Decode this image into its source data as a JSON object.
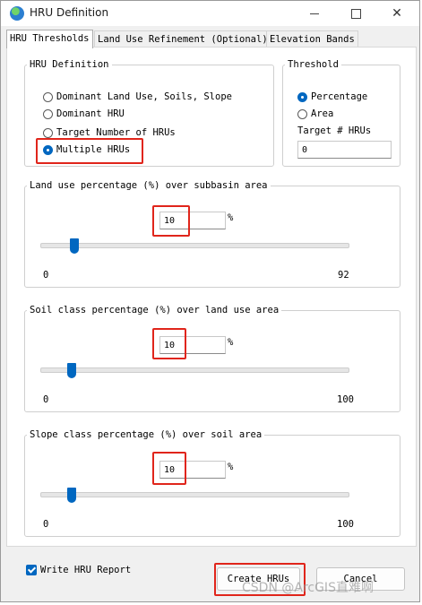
{
  "window": {
    "title": "HRU Definition",
    "minimize_icon": "minimize-icon",
    "maximize_icon": "maximize-icon",
    "close_icon": "close-icon",
    "close_glyph": "✕"
  },
  "tabs": [
    {
      "label": "HRU Thresholds",
      "active": true
    },
    {
      "label": "Land Use Refinement (Optional)",
      "active": false
    },
    {
      "label": "Elevation Bands",
      "active": false
    }
  ],
  "hru_definition": {
    "legend": "HRU Definition",
    "options": [
      {
        "label": "Dominant Land Use, Soils, Slope",
        "checked": false
      },
      {
        "label": "Dominant HRU",
        "checked": false
      },
      {
        "label": "Target Number of HRUs",
        "checked": false
      },
      {
        "label": "Multiple HRUs",
        "checked": true
      }
    ]
  },
  "threshold": {
    "legend": "Threshold",
    "options": [
      {
        "label": "Percentage",
        "checked": true
      },
      {
        "label": "Area",
        "checked": false
      }
    ],
    "target_label": "Target # HRUs",
    "target_value": "0"
  },
  "land_use": {
    "legend": "Land use percentage (%) over subbasin area",
    "value": "10",
    "unit": "%",
    "min_label": "0",
    "max_label": "92",
    "slider_fraction": 0.109
  },
  "soil": {
    "legend": "Soil class percentage (%) over land use area",
    "value": "10",
    "unit": "%",
    "min_label": "0",
    "max_label": "100",
    "slider_fraction": 0.1
  },
  "slope": {
    "legend": "Slope class percentage (%) over soil area",
    "value": "10",
    "unit": "%",
    "min_label": "0",
    "max_label": "100",
    "slider_fraction": 0.1
  },
  "footer": {
    "write_report_label": "Write HRU Report",
    "write_report_checked": true,
    "create_button": "Create HRUs",
    "cancel_button": "Cancel"
  },
  "watermark": "CSDN @ArcGIS直难啊",
  "colors": {
    "accent": "#0067c0",
    "highlight": "#e0251b"
  }
}
